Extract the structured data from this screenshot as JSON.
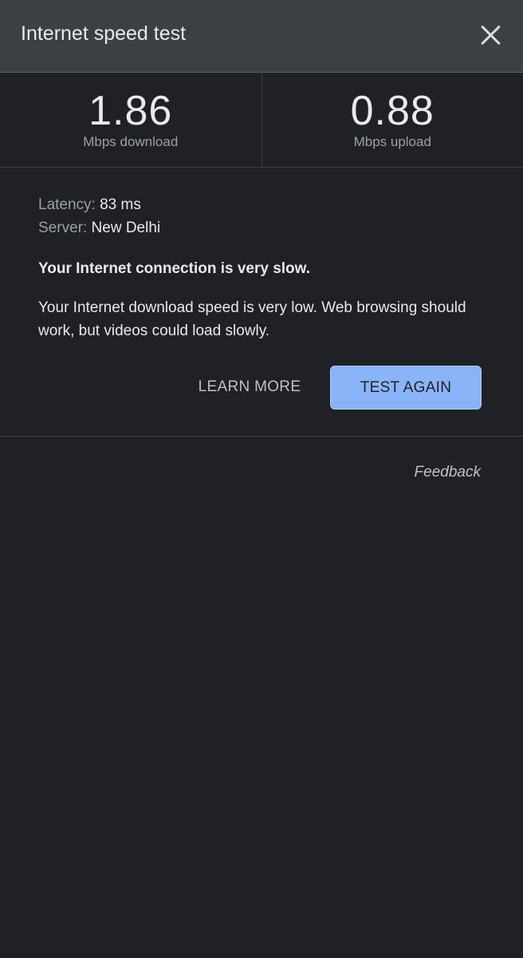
{
  "header": {
    "title": "Internet speed test",
    "close_icon": "close-icon"
  },
  "results": {
    "download": {
      "value": "1.86",
      "unit": "Mbps download"
    },
    "upload": {
      "value": "0.88",
      "unit": "Mbps upload"
    }
  },
  "details": {
    "latency_label": "Latency:",
    "latency_value": "83 ms",
    "server_label": "Server:",
    "server_value": "New Delhi",
    "verdict": "Your Internet connection is very slow.",
    "explanation": "Your Internet download speed is very low. Web browsing should work, but videos could load slowly."
  },
  "actions": {
    "learn_more": "LEARN MORE",
    "test_again": "TEST AGAIN"
  },
  "footer": {
    "feedback": "Feedback"
  },
  "colors": {
    "background": "#202124",
    "header": "#3c4043",
    "accent": "#8ab4f8"
  }
}
